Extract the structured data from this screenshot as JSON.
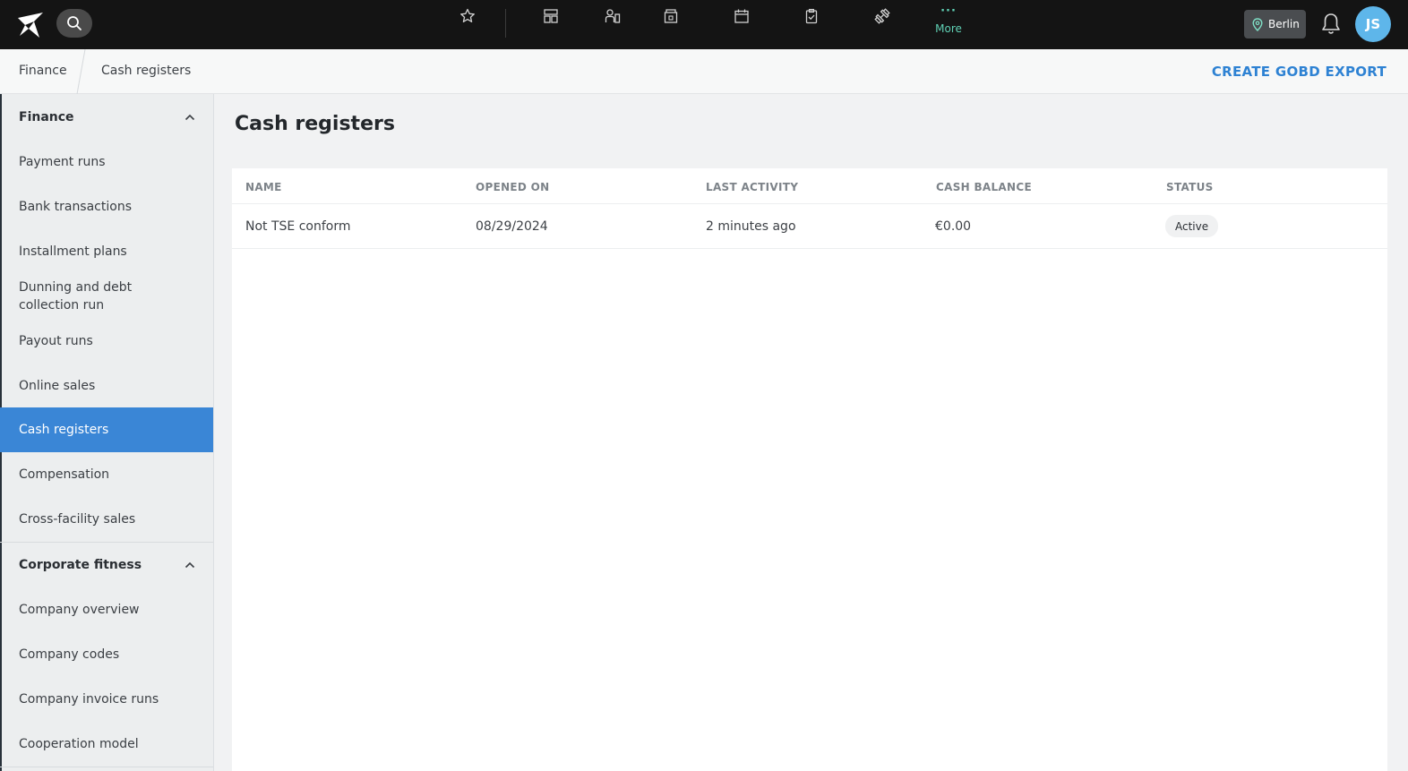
{
  "topbar": {
    "nav_icons": [
      "star-icon",
      "dashboard-icon",
      "members-icon",
      "facility-icon",
      "calendar-icon",
      "clipboard-icon",
      "dumbbell-icon"
    ],
    "more_dots": "···",
    "more_label": "More",
    "more_color": "#5fd0b4",
    "location_label": "Berlin",
    "avatar_initials": "JS",
    "avatar_color": "#5eb6ea"
  },
  "breadcrumb": {
    "items": [
      "Finance",
      "Cash registers"
    ],
    "action_label": "CREATE GOBD EXPORT",
    "action_color": "#2e82d3"
  },
  "sidebar": {
    "sections": [
      {
        "title": "Finance",
        "items": [
          "Payment runs",
          "Bank transactions",
          "Installment plans",
          "Dunning and debt collection run",
          "Payout runs",
          "Online sales",
          "Cash registers",
          "Compensation",
          "Cross-facility sales"
        ]
      },
      {
        "title": "Corporate fitness",
        "items": [
          "Company overview",
          "Company codes",
          "Company invoice runs",
          "Cooperation model"
        ]
      }
    ],
    "active_item": "Cash registers",
    "active_color": "#3a86d6"
  },
  "main": {
    "title": "Cash registers",
    "table": {
      "columns": [
        "NAME",
        "OPENED ON",
        "LAST ACTIVITY",
        "CASH BALANCE",
        "STATUS"
      ],
      "rows": [
        {
          "name": "Not TSE conform",
          "opened_on": "08/29/2024",
          "last_activity": "2 minutes ago",
          "cash_balance": "€0.00",
          "status": "Active"
        }
      ]
    }
  }
}
